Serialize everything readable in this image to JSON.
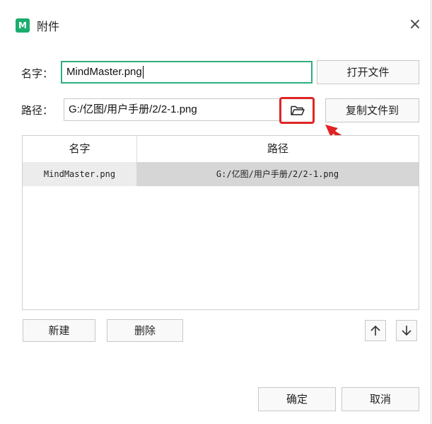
{
  "window": {
    "logo_icon": "app-logo-icon",
    "logo_text": "M",
    "title": "附件",
    "close_icon": "×"
  },
  "form": {
    "name_label": "名字：",
    "name_value": "MindMaster.png",
    "open_file_button": "打开文件",
    "path_label": "路径：",
    "path_value": "G:/亿图/用户手册/2/2-1.png",
    "browse_icon": "folder-open-icon",
    "copy_file_button": "复制文件到"
  },
  "annotation": {
    "highlight_color": "#e02424"
  },
  "table": {
    "columns": [
      "名字",
      "路径"
    ],
    "rows": [
      {
        "name": "MindMaster.png",
        "path": "G:/亿图/用户手册/2/2-1.png"
      }
    ]
  },
  "actions": {
    "new_button": "新建",
    "delete_button": "删除",
    "move_up_icon": "arrow-up-icon",
    "move_down_icon": "arrow-down-icon",
    "ok_button": "确定",
    "cancel_button": "取消"
  },
  "colors": {
    "accent": "#2fae7a",
    "logo": "#1aad6e",
    "selected_row": "#d6d6d6"
  }
}
